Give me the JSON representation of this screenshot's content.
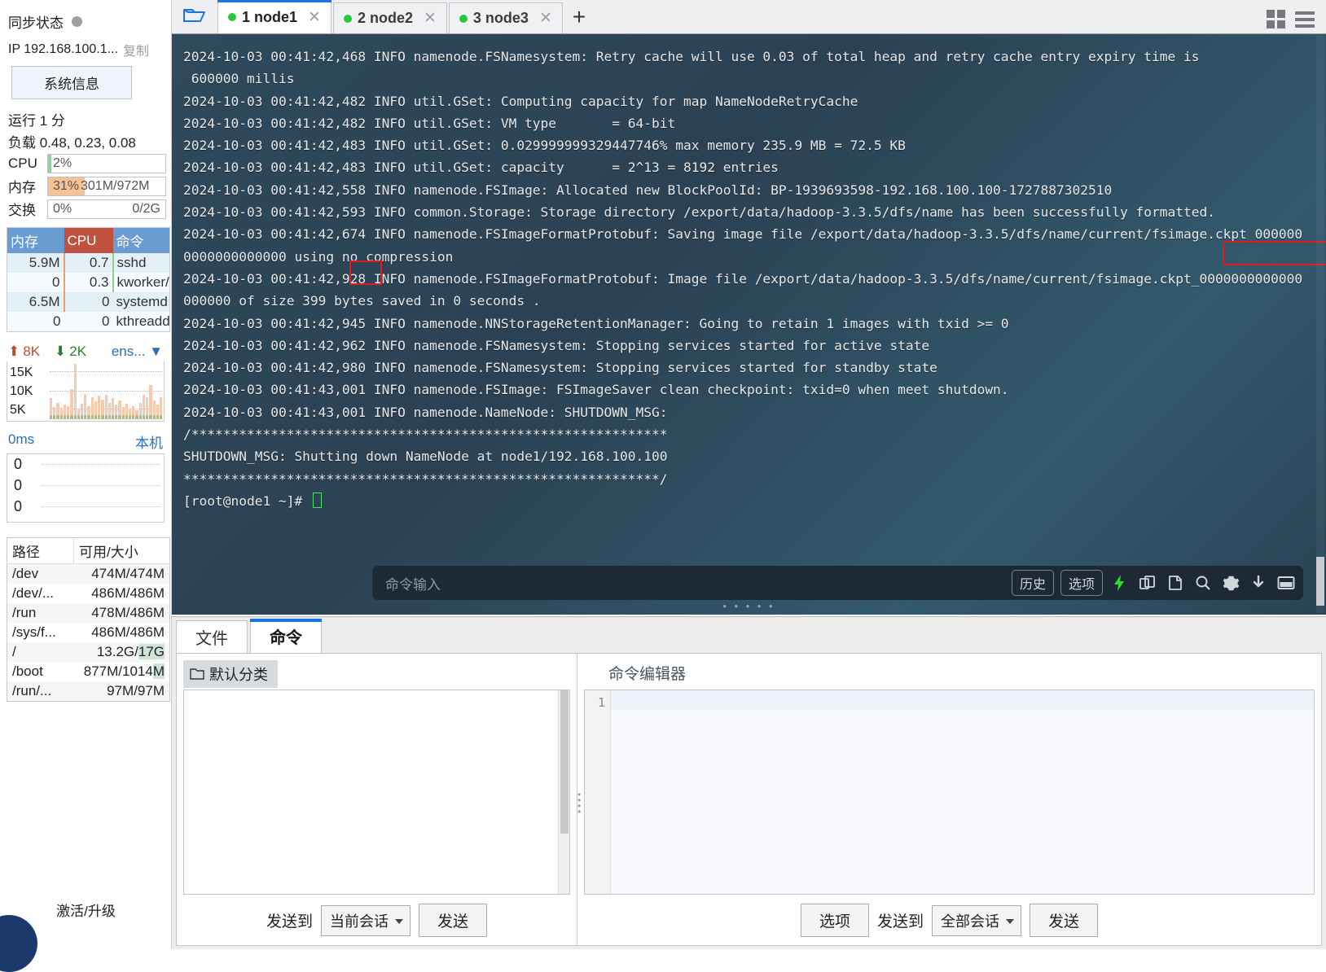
{
  "sidebar": {
    "sync_label": "同步状态",
    "ip_label": "IP 192.168.100.1...",
    "copy_label": "复制",
    "sysinfo_btn": "系统信息",
    "uptime": "运行 1 分",
    "load": "负载 0.48, 0.23, 0.08",
    "meters": [
      {
        "label": "CPU",
        "pct": "2%",
        "value": "",
        "fill": 2,
        "color": "#8fd39a"
      },
      {
        "label": "内存",
        "pct": "31%",
        "value": "301M/972M",
        "fill": 31,
        "color": "#f5c195"
      },
      {
        "label": "交换",
        "pct": "0%",
        "value": "0/2G",
        "fill": 0,
        "color": "#cccccc"
      }
    ],
    "proc_table": {
      "headers": [
        "内存",
        "CPU",
        "命令"
      ],
      "rows": [
        {
          "mem": "5.9M",
          "cpu": "0.7",
          "cmd": "sshd"
        },
        {
          "mem": "0",
          "cpu": "0.3",
          "cmd": "kworker/"
        },
        {
          "mem": "6.5M",
          "cpu": "0",
          "cmd": "systemd"
        },
        {
          "mem": "0",
          "cpu": "0",
          "cmd": "kthreadd"
        }
      ]
    },
    "net": {
      "up": "8K",
      "down": "2K",
      "iface": "ens...",
      "y_labels": [
        "15K",
        "10K",
        "5K"
      ],
      "bars": [
        38,
        22,
        30,
        20,
        26,
        24,
        55,
        100,
        18,
        28,
        46,
        24,
        40,
        32,
        42,
        36,
        44,
        30,
        38,
        26,
        34,
        22,
        28,
        18,
        24,
        16,
        30,
        44,
        40,
        62,
        34,
        26,
        40
      ]
    },
    "latency": {
      "ms": "0ms",
      "host": "本机",
      "y_labels": [
        "0",
        "0",
        "0"
      ]
    },
    "disk_table": {
      "headers": [
        "路径",
        "可用/大小"
      ],
      "rows": [
        {
          "path": "/dev",
          "size": "474M/474M",
          "hl": ""
        },
        {
          "path": "/dev/...",
          "size": "486M/486M",
          "hl": ""
        },
        {
          "path": "/run",
          "size": "478M/486M",
          "hl": ""
        },
        {
          "path": "/sys/f...",
          "size": "486M/486M",
          "hl": ""
        },
        {
          "path": "/",
          "size": "13.2G/",
          "hl": "17G"
        },
        {
          "path": "/boot",
          "size": "877M/1014",
          "hl": "M"
        },
        {
          "path": "/run/...",
          "size": "97M/97M",
          "hl": ""
        }
      ]
    },
    "activate": "激活/升级"
  },
  "tabbar": {
    "folder_icon": "folder-open-icon",
    "tabs": [
      {
        "label": "1 node1",
        "active": true
      },
      {
        "label": "2 node2",
        "active": false
      },
      {
        "label": "3 node3",
        "active": false
      }
    ],
    "new_tab": "+",
    "grid_icon": "grid-view-icon",
    "menu_icon": "hamburger-menu-icon"
  },
  "terminal": {
    "content": "2024-10-03 00:41:42,468 INFO namenode.FSNamesystem: Retry cache will use 0.03 of total heap and retry cache entry expiry time is\n 600000 millis\n2024-10-03 00:41:42,482 INFO util.GSet: Computing capacity for map NameNodeRetryCache\n2024-10-03 00:41:42,482 INFO util.GSet: VM type       = 64-bit\n2024-10-03 00:41:42,483 INFO util.GSet: 0.029999999329447746% max memory 235.9 MB = 72.5 KB\n2024-10-03 00:41:42,483 INFO util.GSet: capacity      = 2^13 = 8192 entries\n2024-10-03 00:41:42,558 INFO namenode.FSImage: Allocated new BlockPoolId: BP-1939693598-192.168.100.100-1727887302510\n2024-10-03 00:41:42,593 INFO common.Storage: Storage directory /export/data/hadoop-3.3.5/dfs/name has been successfully formatted.\n2024-10-03 00:41:42,674 INFO namenode.FSImageFormatProtobuf: Saving image file /export/data/hadoop-3.3.5/dfs/name/current/fsimage.ckpt_0000000000000000000 using no compression\n2024-10-03 00:41:42,928 INFO namenode.FSImageFormatProtobuf: Image file /export/data/hadoop-3.3.5/dfs/name/current/fsimage.ckpt_0000000000000000000 of size 399 bytes saved in 0 seconds .\n2024-10-03 00:41:42,945 INFO namenode.NNStorageRetentionManager: Going to retain 1 images with txid >= 0\n2024-10-03 00:41:42,962 INFO namenode.FSNamesystem: Stopping services started for active state\n2024-10-03 00:41:42,980 INFO namenode.FSNamesystem: Stopping services started for standby state\n2024-10-03 00:41:43,001 INFO namenode.FSImage: FSImageSaver clean checkpoint: txid=0 when meet shutdown.\n2024-10-03 00:41:43,001 INFO namenode.NameNode: SHUTDOWN_MSG:\n/************************************************************\nSHUTDOWN_MSG: Shutting down NameNode at node1/192.168.100.100\n************************************************************/\n",
    "prompt": "[root@node1 ~]# ",
    "highlight_text": "successfully formatted.",
    "highlight_color": "#e01b1b"
  },
  "cmdbar": {
    "placeholder": "命令输入",
    "history_btn": "历史",
    "options_btn": "选项",
    "icons": [
      "lightning-icon",
      "copy-icon",
      "paste-icon",
      "search-icon",
      "gear-icon",
      "download-icon",
      "window-icon"
    ]
  },
  "bottom": {
    "tabs": [
      {
        "label": "文件",
        "active": false
      },
      {
        "label": "命令",
        "active": true
      }
    ],
    "left": {
      "category_label": "默认分类",
      "category_icon": "folder-icon",
      "send_to_label": "发送到",
      "target_value": "当前会话",
      "send_btn": "发送"
    },
    "right": {
      "editor_title": "命令编辑器",
      "line_number": "1",
      "options_btn": "选项",
      "send_to_label": "发送到",
      "target_value": "全部会话",
      "send_btn": "发送"
    }
  }
}
